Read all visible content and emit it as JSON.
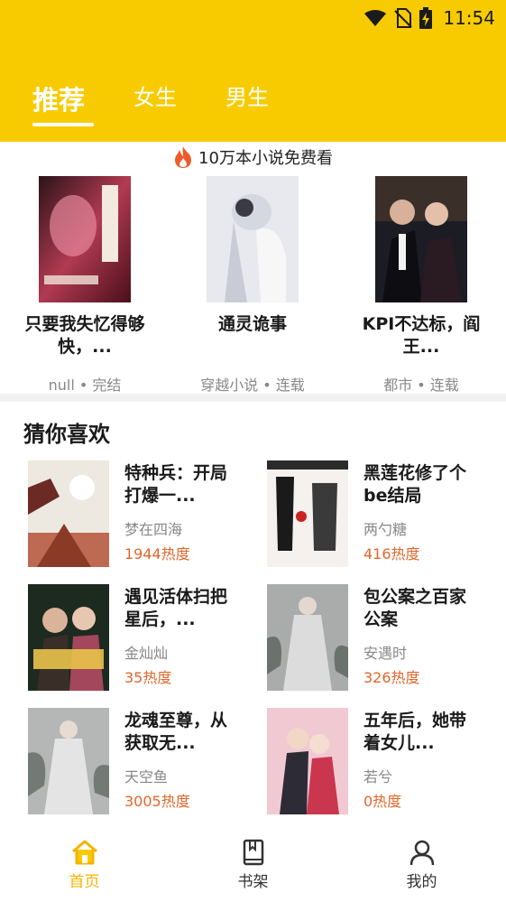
{
  "status": {
    "time": "11:54"
  },
  "tabs": [
    {
      "label": "推荐",
      "active": true
    },
    {
      "label": "女生",
      "active": false
    },
    {
      "label": "男生",
      "active": false
    }
  ],
  "promo": {
    "text": "10万本小说免费看"
  },
  "featured": [
    {
      "title": "只要我失忆得够快，...",
      "meta": "null • 完结"
    },
    {
      "title": "通灵诡事",
      "meta": "穿越小说 • 连载"
    },
    {
      "title": "KPI不达标，阎王...",
      "meta": "都市 • 连载"
    }
  ],
  "guess": {
    "title": "猜你喜欢",
    "books": [
      {
        "title": "特种兵：开局打爆一...",
        "author": "梦在四海",
        "heat": "1944热度"
      },
      {
        "title": "黑莲花修了个be结局",
        "author": "两勺糖",
        "heat": "416热度"
      },
      {
        "title": "遇见活体扫把星后，...",
        "author": "金灿灿",
        "heat": "35热度"
      },
      {
        "title": "包公案之百家公案",
        "author": "安遇时",
        "heat": "326热度"
      },
      {
        "title": "龙魂至尊，从获取无...",
        "author": "天空鱼",
        "heat": "3005热度"
      },
      {
        "title": "五年后，她带着女儿...",
        "author": "若兮",
        "heat": "0热度"
      }
    ]
  },
  "nav": [
    {
      "label": "首页",
      "icon": "home-icon",
      "active": true
    },
    {
      "label": "书架",
      "icon": "bookshelf-icon",
      "active": false
    },
    {
      "label": "我的",
      "icon": "profile-icon",
      "active": false
    }
  ],
  "colors": {
    "header": "#f8cb00",
    "accent": "#f4b400",
    "heat": "#e2662a"
  }
}
